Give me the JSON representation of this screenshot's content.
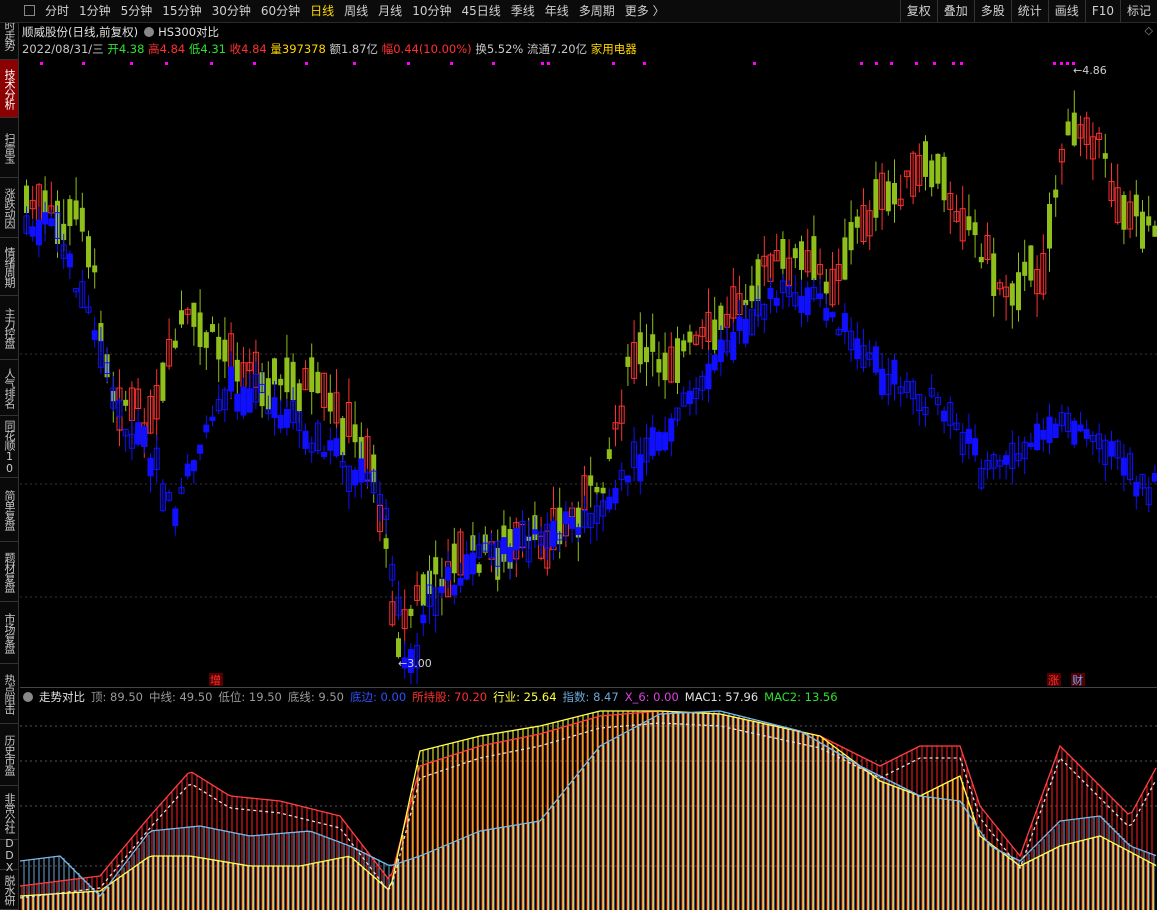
{
  "sidebar": {
    "items": [
      {
        "label": "分时走势",
        "active": false
      },
      {
        "label": "技术分析",
        "active": true
      },
      {
        "label": "扫雷宝",
        "active": false
      },
      {
        "label": "涨跌动因",
        "active": false
      },
      {
        "label": "情绪周期",
        "active": false
      },
      {
        "label": "主力控盘",
        "active": false
      },
      {
        "label": "人气排名",
        "active": false
      },
      {
        "label": "同花顺10",
        "active": false
      },
      {
        "label": "简单复盘",
        "active": false
      },
      {
        "label": "题材复盘",
        "active": false
      },
      {
        "label": "市场复盘",
        "active": false
      },
      {
        "label": "热点阻击",
        "active": false
      },
      {
        "label": "历史市盈",
        "active": false
      },
      {
        "label": "非常公社",
        "active": false
      },
      {
        "label": "DDX",
        "active": false
      },
      {
        "label": "脱水研",
        "active": false
      }
    ]
  },
  "toolbar": {
    "periods": [
      "分时",
      "1分钟",
      "5分钟",
      "15分钟",
      "30分钟",
      "60分钟",
      "日线",
      "周线",
      "月线",
      "10分钟",
      "45日线",
      "季线",
      "年线",
      "多周期",
      "更多 〉"
    ],
    "active_period": "日线",
    "right_buttons": [
      "复权",
      "叠加",
      "多股",
      "统计",
      "画线",
      "F10",
      "标记"
    ]
  },
  "stock": {
    "name": "顺威股份(日线,前复权)",
    "compare": "HS300对比",
    "date": "2022/08/31/三",
    "open_label": "开",
    "open": "4.38",
    "high_label": "高",
    "high": "4.84",
    "low_label": "低",
    "low": "4.31",
    "close_label": "收",
    "close": "4.84",
    "volume_label": "量",
    "volume": "397378",
    "amount_label": "额",
    "amount": "1.87亿",
    "change_label": "幅",
    "change": "0.44(10.00%)",
    "turnover_label": "换",
    "turnover": "5.52%",
    "float_label": "流通",
    "float_cap": "7.20亿",
    "industry": "家用电器"
  },
  "chart_marks": {
    "high_label": "4.86",
    "low_label": "3.00",
    "tag_zeng": "增",
    "tag_zhang": "涨",
    "tag_cai": "财"
  },
  "indicator": {
    "name": "走势对比",
    "items": [
      {
        "label": "顶: 89.50",
        "color": "#9a9a9a"
      },
      {
        "label": "中线: 49.50",
        "color": "#9a9a9a"
      },
      {
        "label": "低位: 19.50",
        "color": "#9a9a9a"
      },
      {
        "label": "底线: 9.50",
        "color": "#9a9a9a"
      },
      {
        "label": "底边: 0.00",
        "color": "#3050ff"
      },
      {
        "label": "所持股: 70.20",
        "color": "#ff3030"
      },
      {
        "label": "行业: 25.64",
        "color": "#ffff40"
      },
      {
        "label": "指数: 8.47",
        "color": "#6aa8d8"
      },
      {
        "label": "X_6: 0.00",
        "color": "#e040e0"
      },
      {
        "label": "MAC1: 57.96",
        "color": "#e0e0e0"
      },
      {
        "label": "MAC2: 13.56",
        "color": "#30e030"
      }
    ]
  },
  "colors": {
    "up": "#ff3030",
    "down": "#00e0e0",
    "green_candle": "#8fbf1a",
    "blue_candle": "#1010ff",
    "accent": "#ffd700"
  }
}
